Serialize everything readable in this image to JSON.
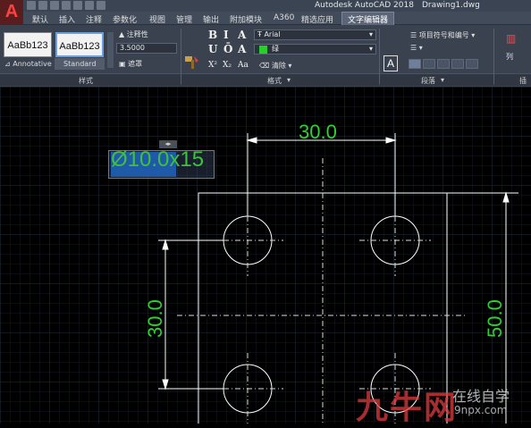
{
  "app": {
    "logo_letter": "A",
    "title": "Autodesk AutoCAD 2018",
    "file_name": "Drawing1.dwg"
  },
  "tabs": [
    {
      "label": "默认"
    },
    {
      "label": "插入"
    },
    {
      "label": "注释"
    },
    {
      "label": "参数化"
    },
    {
      "label": "视图"
    },
    {
      "label": "管理"
    },
    {
      "label": "输出"
    },
    {
      "label": "附加模块"
    },
    {
      "label": "A360"
    },
    {
      "label": "精选应用"
    },
    {
      "label": "文字编辑器",
      "active": true
    }
  ],
  "ribbon": {
    "style_panel": {
      "tiles": [
        {
          "preview": "AaBb123",
          "name": "Annotative"
        },
        {
          "preview": "AaBb123",
          "name": "Standard",
          "selected": true
        }
      ],
      "annotative_label": "注释性",
      "height_value": "3.5000",
      "mask_label": "遮罩",
      "panel_label": "样式"
    },
    "format_panel": {
      "match_label": "匹配",
      "bold": "B",
      "italic": "I",
      "strike": "A",
      "underline": "U",
      "overline": "Ō",
      "case": "A",
      "superscript": "X²",
      "subscript": "X₂",
      "font_case": "Aa",
      "clear_label": "清除",
      "font_name": "Arial",
      "color_name": "绿",
      "color_hex": "#26d026",
      "panel_label": "格式"
    },
    "paragraph_panel": {
      "justify_label": "对正",
      "bullets_label": "项目符号和编号",
      "panel_label": "段落"
    },
    "insert_panel": {
      "columns_label": "列",
      "panel_label": "插"
    }
  },
  "drawing": {
    "mtext_editor": {
      "text": "Ø10.0x15",
      "selected_part": "Ø10.0",
      "grip": "◂▸"
    },
    "dimensions": {
      "top": "30.0",
      "left": "30.0",
      "right": "50.0"
    },
    "colors": {
      "dimension_text": "#2fd02f",
      "grid": "#1f2f3f",
      "geometry": "#ffffff"
    }
  },
  "watermark": {
    "brand": "九牛网",
    "slogan": "在线自学",
    "url": "9npx.com"
  }
}
